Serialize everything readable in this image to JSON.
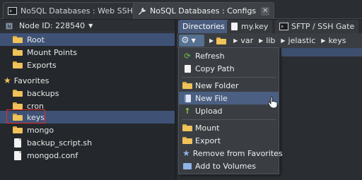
{
  "tabs": [
    {
      "label": "NoSQL Databases : Web SSH",
      "active": false
    },
    {
      "label": "NoSQL Databases : Configs",
      "active": true
    }
  ],
  "tab_close_glyph": "✕",
  "node": {
    "label": "Node ID: 228540"
  },
  "tree": {
    "root": [
      "Root",
      "Mount Points",
      "Exports"
    ],
    "favorites_label": "Favorites",
    "favorites": [
      "backups",
      "cron",
      "keys",
      "mongo",
      "backup_script.sh",
      "mongod.conf"
    ]
  },
  "subtabs": [
    "Directories",
    "my.key",
    "SFTP / SSH Gate"
  ],
  "breadcrumb": [
    "var",
    "lib",
    "jelastic",
    "keys"
  ],
  "context_menu": {
    "items": [
      "Refresh",
      "Copy Path",
      "New Folder",
      "New File",
      "Upload",
      "Mount",
      "Export",
      "Remove from Favorites",
      "Add to Volumes"
    ],
    "highlighted": "New File"
  },
  "colors": {
    "selection": "#3f5276",
    "highlight": "#4b5f82",
    "keys_outline": "#e02d2d",
    "folder": "#f0c25a"
  },
  "icons": [
    "terminal-icon",
    "wrench-icon",
    "node-icon",
    "folder-icon",
    "star-icon",
    "file-icon",
    "key-file-icon",
    "gear-icon",
    "refresh-icon",
    "copy-icon",
    "new-folder-icon",
    "new-file-icon",
    "upload-icon",
    "mount-icon",
    "export-icon",
    "remove-favorite-icon",
    "volumes-icon",
    "hand-cursor-icon"
  ]
}
